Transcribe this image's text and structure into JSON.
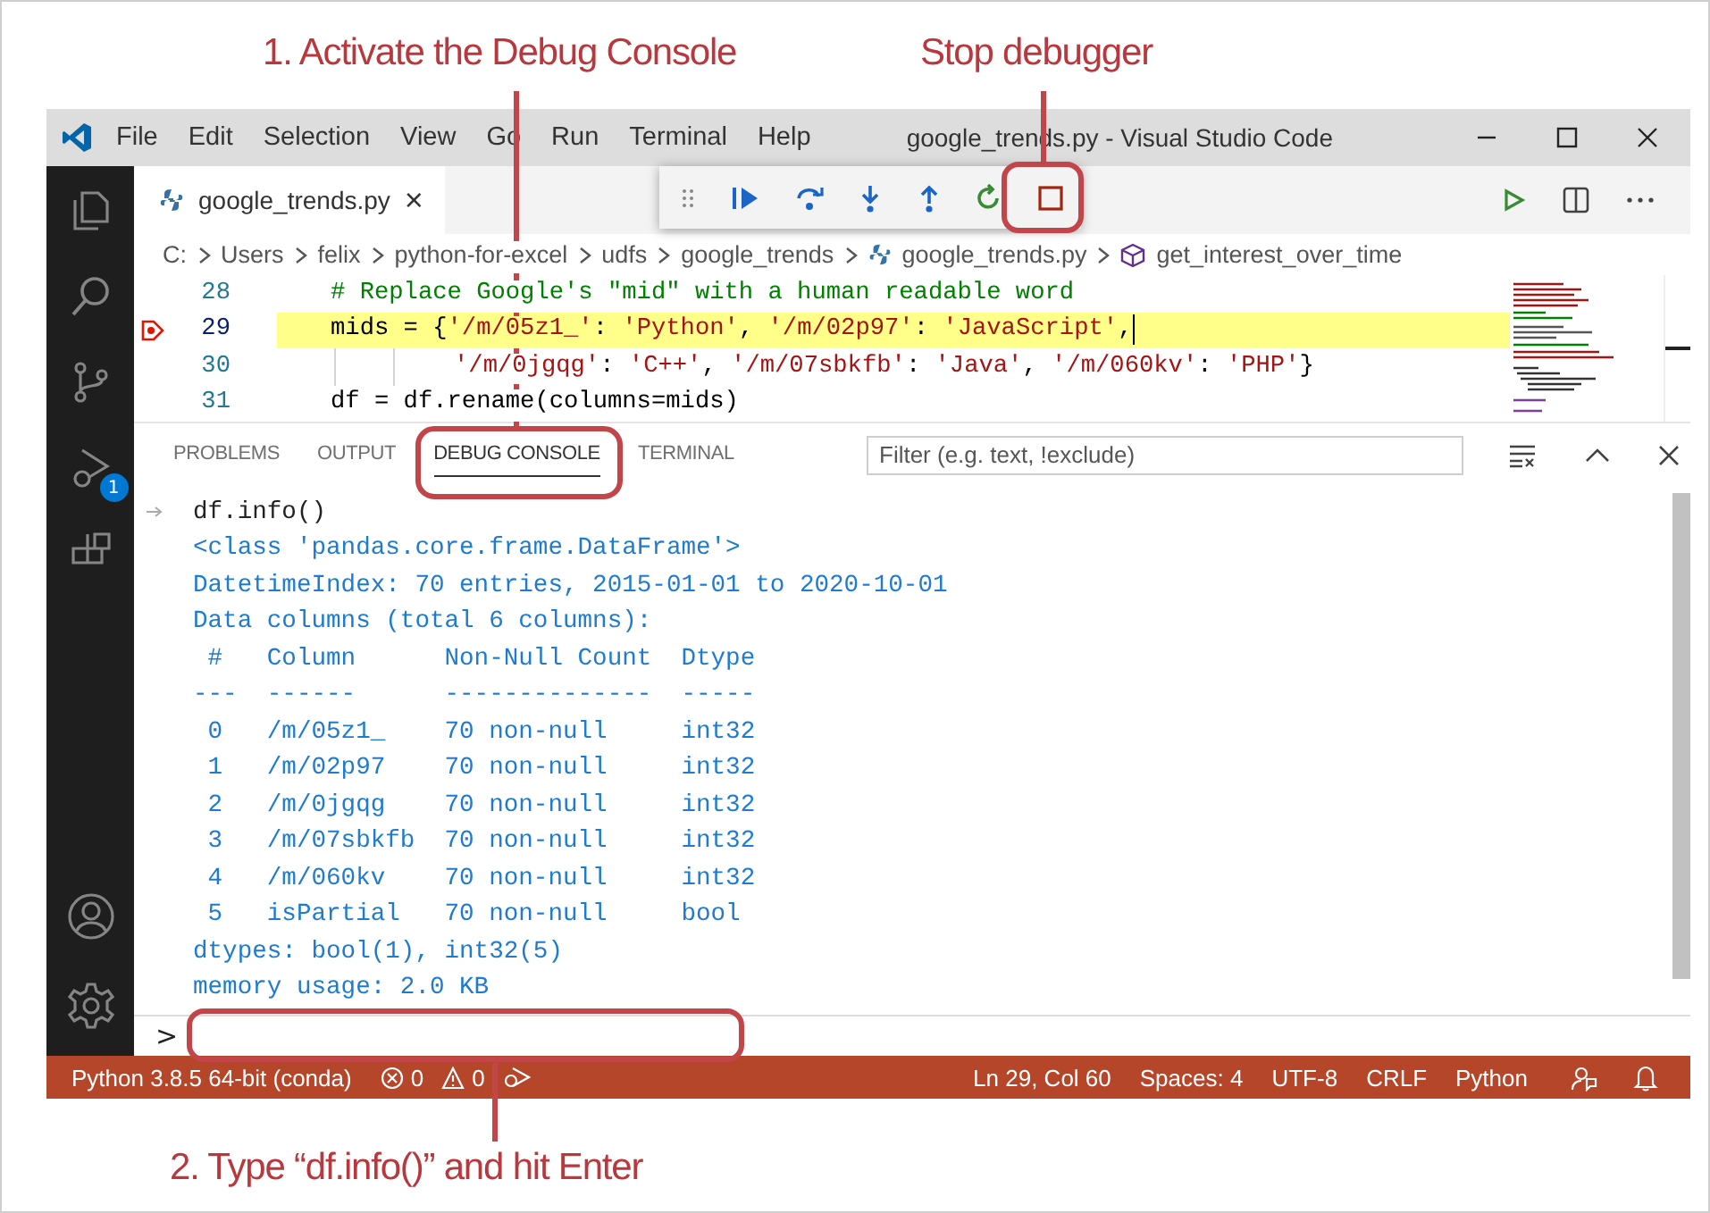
{
  "callouts": {
    "debug_console": "1. Activate the Debug Console",
    "stop": "Stop debugger",
    "input": "2. Type “df.info()” and hit Enter"
  },
  "window": {
    "title": "google_trends.py - Visual Studio Code",
    "menu": [
      "File",
      "Edit",
      "Selection",
      "View",
      "Go",
      "Run",
      "Terminal",
      "Help"
    ]
  },
  "activity_bar": {
    "debug_badge": "1"
  },
  "editor_tab": {
    "label": "google_trends.py",
    "close": "×"
  },
  "breadcrumb": [
    "C:",
    "Users",
    "felix",
    "python-for-excel",
    "udfs",
    "google_trends",
    "google_trends.py",
    "get_interest_over_time"
  ],
  "code_lines": [
    {
      "number": "28",
      "kind": "normal",
      "current": false,
      "tokens": [
        {
          "kind": "comment",
          "text": "# Replace Google's \"mid\" with a human readable word"
        }
      ]
    },
    {
      "number": "29",
      "kind": "normal",
      "current": true,
      "tokens": [
        {
          "kind": "plain",
          "text": "mids = {"
        },
        {
          "kind": "string",
          "text": "'/m/05z1_'"
        },
        {
          "kind": "plain",
          "text": ": "
        },
        {
          "kind": "string",
          "text": "'Python'"
        },
        {
          "kind": "plain",
          "text": ", "
        },
        {
          "kind": "string",
          "text": "'/m/02p97'"
        },
        {
          "kind": "plain",
          "text": ": "
        },
        {
          "kind": "string",
          "text": "'JavaScript'"
        },
        {
          "kind": "plain",
          "text": ","
        }
      ]
    },
    {
      "number": "30",
      "kind": "continuation",
      "current": false,
      "tokens": [
        {
          "kind": "string",
          "text": "'/m/0jgqg'"
        },
        {
          "kind": "plain",
          "text": ": "
        },
        {
          "kind": "string",
          "text": "'C++'"
        },
        {
          "kind": "plain",
          "text": ", "
        },
        {
          "kind": "string",
          "text": "'/m/07sbkfb'"
        },
        {
          "kind": "plain",
          "text": ": "
        },
        {
          "kind": "string",
          "text": "'Java'"
        },
        {
          "kind": "plain",
          "text": ", "
        },
        {
          "kind": "string",
          "text": "'/m/060kv'"
        },
        {
          "kind": "plain",
          "text": ": "
        },
        {
          "kind": "string",
          "text": "'PHP'"
        },
        {
          "kind": "plain",
          "text": "}"
        }
      ]
    },
    {
      "number": "31",
      "kind": "normal",
      "current": false,
      "tokens": [
        {
          "kind": "plain",
          "text": "df = df.rename(columns=mids)"
        }
      ]
    }
  ],
  "panel_tabs": [
    {
      "label": "PROBLEMS",
      "selected": false
    },
    {
      "label": "OUTPUT",
      "selected": false
    },
    {
      "label": "DEBUG CONSOLE",
      "selected": true
    },
    {
      "label": "TERMINAL",
      "selected": false
    }
  ],
  "filter": {
    "placeholder": "Filter (e.g. text, !exclude)"
  },
  "console_lines": [
    {
      "kind": "input",
      "text": "df.info()"
    },
    {
      "kind": "output",
      "text": "<class 'pandas.core.frame.DataFrame'>"
    },
    {
      "kind": "output",
      "text": "DatetimeIndex: 70 entries, 2015-01-01 to 2020-10-01"
    },
    {
      "kind": "output",
      "text": "Data columns (total 6 columns):"
    },
    {
      "kind": "output",
      "text": " #   Column      Non-Null Count  Dtype"
    },
    {
      "kind": "output",
      "text": "---  ------      --------------  -----"
    },
    {
      "kind": "output",
      "text": " 0   /m/05z1_    70 non-null     int32"
    },
    {
      "kind": "output",
      "text": " 1   /m/02p97    70 non-null     int32"
    },
    {
      "kind": "output",
      "text": " 2   /m/0jgqg    70 non-null     int32"
    },
    {
      "kind": "output",
      "text": " 3   /m/07sbkfb  70 non-null     int32"
    },
    {
      "kind": "output",
      "text": " 4   /m/060kv    70 non-null     int32"
    },
    {
      "kind": "output",
      "text": " 5   isPartial   70 non-null     bool"
    },
    {
      "kind": "output",
      "text": "dtypes: bool(1), int32(5)"
    },
    {
      "kind": "output",
      "text": "memory usage: 2.0 KB"
    }
  ],
  "console_prompt": ">",
  "status_bar": {
    "interpreter": "Python 3.8.5 64-bit (conda)",
    "errors": "0",
    "warnings": "0",
    "right": [
      "Ln 29, Col 60",
      "Spaces: 4",
      "UTF-8",
      "CRLF",
      "Python"
    ]
  }
}
